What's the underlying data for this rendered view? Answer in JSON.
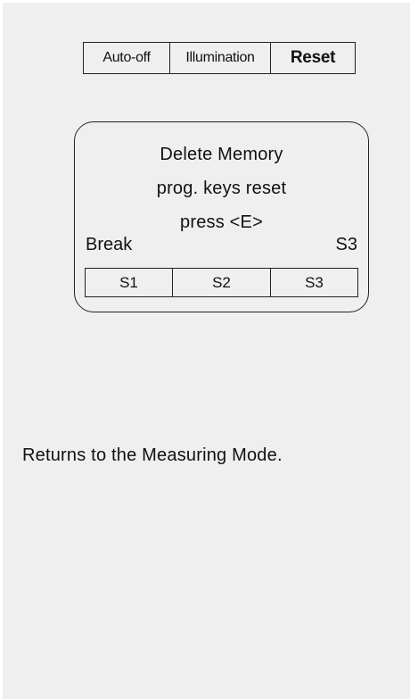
{
  "tabs": [
    {
      "label": "Auto-off"
    },
    {
      "label": "Illumination"
    },
    {
      "label": "Reset"
    }
  ],
  "display": {
    "line1": "Delete Memory",
    "line2": "prog. keys reset",
    "line3": "press  <E>",
    "left_label": "Break",
    "right_label": "S3"
  },
  "softkeys": [
    {
      "label": "S1"
    },
    {
      "label": "S2"
    },
    {
      "label": "S3"
    }
  ],
  "caption": "Returns to the Measuring Mode."
}
